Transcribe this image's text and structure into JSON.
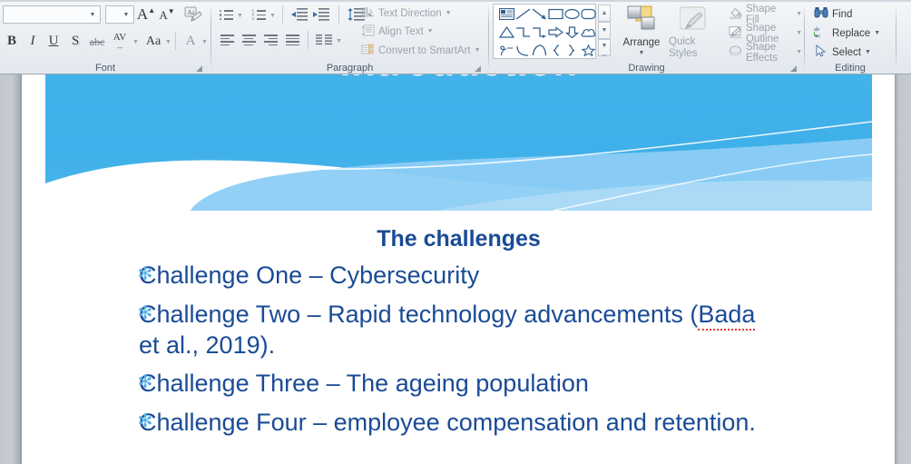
{
  "ribbon": {
    "groups": [
      {
        "name": "Font",
        "label": "Font"
      },
      {
        "name": "Paragraph",
        "label": "Paragraph"
      },
      {
        "name": "Drawing",
        "label": "Drawing"
      },
      {
        "name": "Editing",
        "label": "Editing"
      }
    ],
    "font_group": {
      "font_name": {
        "value": "",
        "placeholder": ""
      },
      "font_size": {
        "value": "",
        "placeholder": ""
      },
      "grow_font_label": "A",
      "shrink_font_label": "A",
      "clear_formatting_label": "Aa",
      "bold_label": "B",
      "italic_label": "I",
      "underline_label": "U",
      "shadow_label": "S",
      "strikethrough_label": "abc",
      "character_spacing_label": "AV",
      "change_case_label": "Aa",
      "font_color_label": "A"
    },
    "paragraph_group": {
      "text_direction_label": "Text Direction",
      "align_text_label": "Align Text",
      "convert_to_smartart_label": "Convert to SmartArt"
    },
    "drawing_group": {
      "arrange_label": "Arrange",
      "quick_styles_label": "Quick Styles",
      "shape_fill_label": "Shape Fill",
      "shape_outline_label": "Shape Outline",
      "shape_effects_label": "Shape Effects",
      "shapes": [
        "text-box-shape",
        "line-shape",
        "arrow-line-shape",
        "rectangle-shape",
        "oval-shape",
        "rounded-rectangle-shape",
        "triangle-shape",
        "elbow-connector-shape",
        "elbow-arrow-connector-shape",
        "right-arrow-shape",
        "down-arrow-shape",
        "cloud-shape",
        "scribble-shape",
        "curve-shape",
        "arc-shape",
        "left-brace-shape",
        "right-brace-shape",
        "star-shape"
      ]
    },
    "editing_group": {
      "find_label": "Find",
      "replace_label": "Replace",
      "select_label": "Select"
    }
  },
  "slide": {
    "title": "Introduction",
    "heading": "The challenges",
    "bullet_mark": "✻",
    "bullets": [
      {
        "text": "Challenge One – Cybersecurity"
      },
      {
        "text": "Challenge Two – Rapid technology advancements (Bada et al., 2019).",
        "pre": "Challenge Two – Rapid technology advancements (",
        "misspelled": "Bada",
        "post": " et al., 2019)."
      },
      {
        "text": "Challenge Three – The ageing population"
      },
      {
        "text": "Challenge Four – employee compensation and retention."
      }
    ],
    "colors": {
      "banner_blue_top": "#3fb0e9",
      "banner_blue_light": "#8ccdf5",
      "body_text_navy": "#1a4b96",
      "bullet_blue": "#52b0e8",
      "misspell_underline": "#e03a3a"
    }
  }
}
